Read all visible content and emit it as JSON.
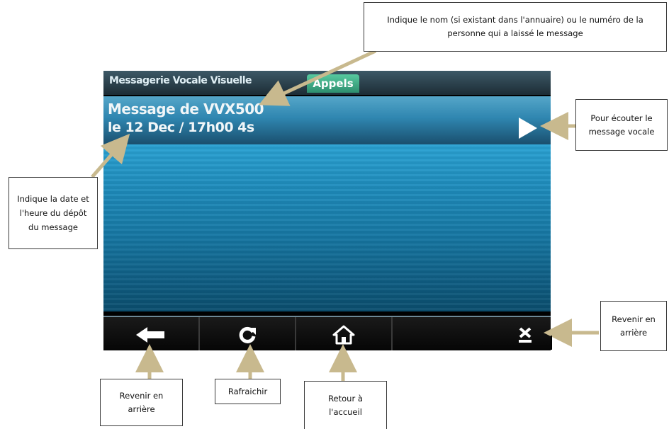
{
  "screen": {
    "title": "Messagerie Vocale Visuelle",
    "tab_label": "Appels",
    "message": {
      "from": "Message de VVX500",
      "date": "le 12 Dec / 17h00 4s"
    },
    "play_icon": "play-icon",
    "softkeys": [
      {
        "icon": "arrow-left-icon"
      },
      {
        "icon": "refresh-icon"
      },
      {
        "icon": "home-icon"
      },
      {
        "icon": "close-icon"
      }
    ]
  },
  "callouts": {
    "name": "Indique le nom (si existant dans l'annuaire) ou le numéro de la personne qui a laissé le message",
    "listen": "Pour écouter le message vocale",
    "date": "Indique la date et l'heure du dépôt du message",
    "back_right": "Revenir en arrière",
    "back_left": "Revenir en arrière",
    "refresh": "Rafraichir",
    "home": "Retour à l'accueil"
  },
  "colors": {
    "accent_tab": "#3fae86",
    "screen_blue": "#1f8dbd",
    "arrow_color": "#c8b98e"
  }
}
